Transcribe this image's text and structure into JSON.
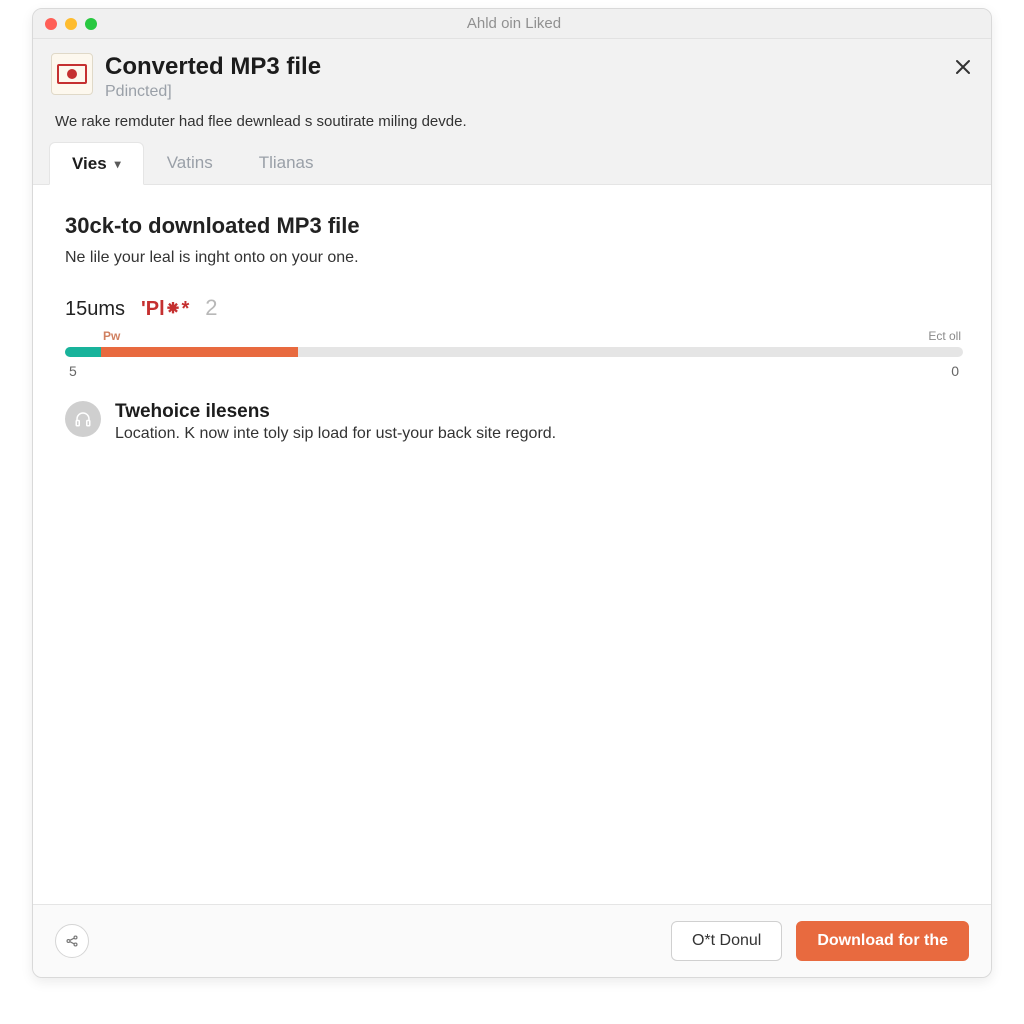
{
  "titlebar": {
    "title": "Ahld oin Liked"
  },
  "header": {
    "title": "Converted MP3 file",
    "subtitle": "Pdincted]"
  },
  "intro": "We rake remduter had flee dewnlead s soutirate miling devde.",
  "tabs": [
    {
      "label": "Vies",
      "active": true,
      "dropdown": true
    },
    {
      "label": "Vatins"
    },
    {
      "label": "Tlianas"
    }
  ],
  "main": {
    "heading": "30ck-to downloated MP3 file",
    "subtext": "Ne lile your leal is inght onto on your one.",
    "metrics": {
      "m1": "15ums",
      "m2": "'Pl⁕*",
      "m3": "2"
    },
    "progress": {
      "top_left": "Pw",
      "top_right": "Ect oll",
      "bottom_left": "5",
      "bottom_right": "0",
      "seg1_pct": 4,
      "seg2_pct": 22
    },
    "info": {
      "title": "Twehoice ilesens",
      "sub": "Location. K now inte toly sip load for ust-your back site regord."
    }
  },
  "footer": {
    "secondary_label": "O*t Donul",
    "primary_label": "Download for the"
  }
}
